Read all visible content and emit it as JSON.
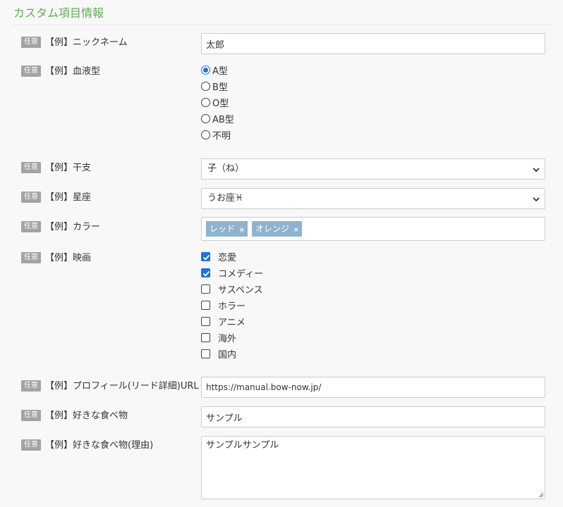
{
  "section": {
    "title": "カスタム項目情報"
  },
  "optional_badge": "任意",
  "fields": {
    "nickname": {
      "label": "【例】ニックネーム",
      "value": "太郎"
    },
    "blood_type": {
      "label": "【例】血液型",
      "options": [
        "A型",
        "B型",
        "O型",
        "AB型",
        "不明"
      ],
      "selected": "A型"
    },
    "eto": {
      "label": "【例】干支",
      "value": "子（ね）"
    },
    "constellation": {
      "label": "【例】星座",
      "value": "うお座♓"
    },
    "color": {
      "label": "【例】カラー",
      "tags": [
        "レッド",
        "オレンジ"
      ],
      "remove_icon": "×"
    },
    "movie": {
      "label": "【例】映画",
      "options": [
        "恋愛",
        "コメディー",
        "サスペンス",
        "ホラー",
        "アニメ",
        "海外",
        "国内"
      ],
      "checked": [
        "恋愛",
        "コメディー"
      ]
    },
    "profile_url": {
      "label": "【例】プロフィール(リード詳細)URL",
      "value": "https://manual.bow-now.jp/"
    },
    "favorite_food": {
      "label": "【例】好きな食べ物",
      "value": "サンプル"
    },
    "favorite_food_reason": {
      "label": "【例】好きな食べ物(理由)",
      "value": "サンプルサンプル"
    }
  },
  "colors": {
    "section_title": "#5fae55",
    "badge_bg": "#a3a3a3",
    "accent": "#1a73e8",
    "tag_bg": "#8fb3cf"
  }
}
